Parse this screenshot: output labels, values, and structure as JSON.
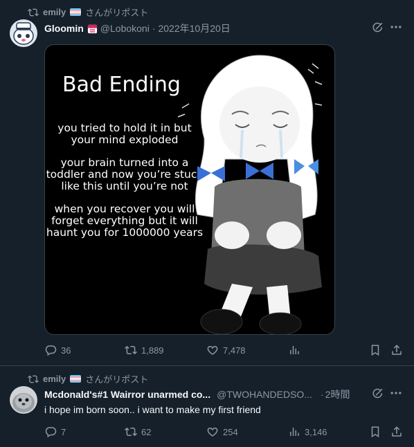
{
  "tweets": [
    {
      "repost": {
        "user": "emily",
        "suffix": "さんがリポスト"
      },
      "author": {
        "name": "Gloomin",
        "handle": "@Lobokoni",
        "separator": "·",
        "time": "2022年10月20日"
      },
      "media": {
        "title": "Bad Ending",
        "paragraphs": [
          "you tried to hold it in but your mind exploded",
          "your brain turned into a toddler and now you’re stuck like this until you’re not",
          "when you recover you will forget everything but it will haunt you for 1000000 years"
        ]
      },
      "stats": {
        "replies": "36",
        "reposts": "1,889",
        "likes": "7,478",
        "views": ""
      }
    },
    {
      "repost": {
        "user": "emily",
        "suffix": "さんがリポスト"
      },
      "author": {
        "name": "Mcdonald's#1 Wairror unarmed co...",
        "handle": "@TWOHANDEDSO...",
        "separator": "·",
        "time": "2時間"
      },
      "text": "i hope im born soon.. i want to make my first friend",
      "stats": {
        "replies": "7",
        "reposts": "62",
        "likes": "254",
        "views": "3,146"
      }
    }
  ],
  "colors": {
    "background": "#15202b",
    "text": "#f7f9f9",
    "secondary": "#8b98a5",
    "border": "#38444d"
  },
  "icons": [
    "repost-icon",
    "trans-flag-icon",
    "calendar-badge-icon",
    "grok-icon",
    "more-icon",
    "reply-icon",
    "like-icon",
    "views-icon",
    "bookmark-icon",
    "share-icon"
  ]
}
